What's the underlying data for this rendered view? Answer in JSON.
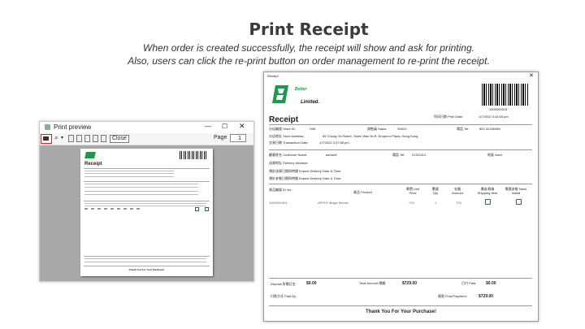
{
  "slide": {
    "title": "Print Receipt",
    "line1": "When order is created successfully, the receipt will show and ask for printing.",
    "line2": "Also, users can click the  re-print button on order management to re-print the receipt."
  },
  "preview": {
    "window_title": "Print preview",
    "close_label": "Close",
    "page_label": "Page",
    "page_value": "1",
    "mini": {
      "heading": "Receipt",
      "thanks": "Thank You For Your Purchase!"
    }
  },
  "receipt": {
    "window_title": "Receipt",
    "brand_top": "Better",
    "brand_bottom": "Limited.",
    "heading": "Receipt",
    "barcode_number": "1000000015",
    "print_date_label": "列印日期 Print Date:",
    "print_date_value": "1/7/2022 3:43:05 pm",
    "store_id_label": "分店編號 Store ID:",
    "store_id_value": "H08",
    "sales_label": "銷售員 Sales:",
    "sales_value": "S0001",
    "tel_label": "電話 Tel:",
    "tel_value": "852 32165498",
    "store_address_label": "分店地址 Store Address:",
    "store_address_value": "55 Chung On Street, Tsuen Wan KLR, Emperor Plaza, Hong Kong",
    "txn_date_label": "交易日期 Transaction Date:",
    "txn_date_value": "1/7/2022 3:37:58 pm",
    "customer_label": "顧客姓名 Customer Name:",
    "customer_value": "ashwell",
    "cust_tel_label": "電話 Tel:",
    "cust_tel_value": "21321112",
    "area_label": "地區 Area:",
    "delivery_address_label": "送貨地址 Delivery Address:",
    "expect_delivery_label": "預計送貨日期與時間 Expect Delivery Date & Time:",
    "expect_install_label": "預計安裝日期與時間 Expect Delivery Date & Time:",
    "columns": [
      "貨品編號 ID No.",
      "貨品 Product",
      "單價 Unit Price",
      "數量 Qty",
      "金額 Amount",
      "運送/取貨 Shipping Item",
      "需要安裝 Need Install"
    ],
    "items": [
      {
        "id": "1000000204",
        "product": "APPLE Magic Mouse",
        "price": "729",
        "qty": "1",
        "amount": "729"
      }
    ],
    "deposit_label": "Deposit 所需訂金:",
    "deposit_value": "$0.00",
    "total_label": "Total Amount 總額:",
    "total_value": "$729.00",
    "paid_label": "已付 Paid:",
    "paid_value": "$0.00",
    "paid_by_label": "付款方式 Paid By:",
    "final_payment_label": "尾款 Final Payment:",
    "final_payment_value": "$729.00",
    "thanks": "Thank You For Your Purchase!"
  },
  "colors": {
    "brand_green": "#1a9a4a",
    "highlight_red": "#e02020"
  }
}
